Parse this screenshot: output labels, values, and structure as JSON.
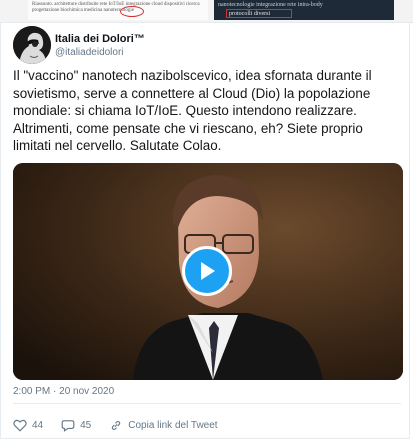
{
  "top_strip": {
    "left_text": "Riassunto. architetture distribuite rete IoT/IoE integrazione cloud dispositivi ricerca progettazione biochimica medicina nanotecnologie",
    "right_text": "nanotecnologie integrazione rete intra-body",
    "right_highlight": "protocolli diversi"
  },
  "account": {
    "name": "Italia dei Dolori™",
    "handle": "@italiadeidolori",
    "avatar_icon": "avatar-woman-silhouette"
  },
  "tweet": {
    "text": "Il \"vaccino\" nanotech nazibolscevico, idea sfornata durante il sovietismo, serve a connettere al Cloud (Dio) la popolazione mondiale: si chiama IoT/IoE. Questo intendono realizzare. Altrimenti, come pensate che vi riescano, eh? Siete proprio limitati nel cervello. Salutate Colao.",
    "timestamp": "2:00 PM · 20 nov 2020"
  },
  "video": {
    "play_icon": "play-icon",
    "accent": "#1da1f2"
  },
  "actions": {
    "likes": "44",
    "replies": "45",
    "copy_link_label": "Copia link del Tweet"
  }
}
